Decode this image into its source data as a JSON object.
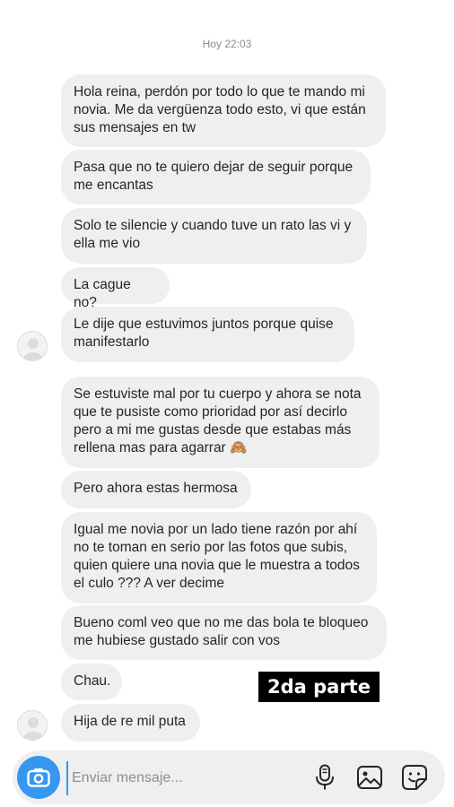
{
  "timestamp": "Hoy 22:03",
  "messages": [
    "Hola reina, perdón por todo lo que te mando mi\nnovia. Me da vergüenza todo esto, vi que están\nsus mensajes en tw",
    "Pasa que no te quiero dejar de seguir porque\nme encantas",
    "Solo te silencie y cuando tuve un rato las vi y\nella me vio",
    "La cague no?",
    "Le dije que estuvimos juntos porque quise\nmanifestarlo",
    "Se estuviste mal por tu cuerpo y ahora se nota\nque te pusiste como prioridad por así decirlo\npero a mi me gustas desde que estabas más\nrellena mas para agarrar 🙈",
    "Pero ahora estas hermosa",
    "Igual me novia por un lado tiene razón por ahí\nno te toman en serio por las fotos que subis,\nquien quiere una novia que le muestra a todos\nel culo ??? A ver decime",
    "Bueno coml veo que no me das bola te bloqueo\nme hubiese gustado salir con vos",
    "Chau.",
    "Hija de re mil puta"
  ],
  "overlay_tag": "2da parte",
  "composer": {
    "placeholder": "Enviar mensaje...",
    "icons": [
      "camera-icon",
      "microphone-icon",
      "image-icon",
      "sticker-icon"
    ]
  },
  "colors": {
    "bubble": "#efefef",
    "accent": "#3797f0",
    "timestamp": "#8e8e8e"
  }
}
